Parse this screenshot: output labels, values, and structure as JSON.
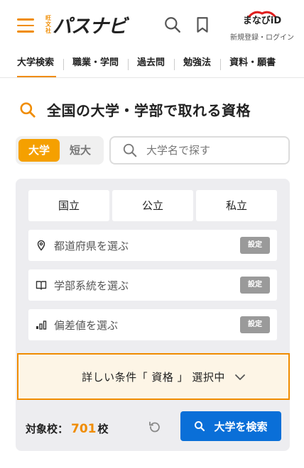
{
  "header": {
    "logo_small": [
      "旺",
      "文",
      "社"
    ],
    "logo_main": "パスナビ",
    "manabi_logo": "まなびiD",
    "manabi_sub": "新規登録・ログイン"
  },
  "nav": {
    "items": [
      {
        "label": "大学検索",
        "active": true
      },
      {
        "label": "職業・学問",
        "active": false
      },
      {
        "label": "過去問",
        "active": false
      },
      {
        "label": "勉強法",
        "active": false
      },
      {
        "label": "資料・願書",
        "active": false
      }
    ]
  },
  "section": {
    "title": "全国の大学・学部で取れる資格"
  },
  "toggle": {
    "options": [
      "大学",
      "短大"
    ],
    "selected": "大学"
  },
  "search": {
    "placeholder": "大学名で探す"
  },
  "filters": {
    "types": [
      "国立",
      "公立",
      "私立"
    ],
    "prefecture": "都道府県を選ぶ",
    "faculty": "学部系統を選ぶ",
    "deviation": "偏差値を選ぶ",
    "set_label": "設定",
    "detail": "詳しい条件「 資格 」 選択中"
  },
  "results": {
    "count_label": "対象校：",
    "count": "701",
    "count_unit": "校",
    "search_button": "大学を検索"
  },
  "colors": {
    "accent": "#f08c00",
    "primary": "#0a6fd8",
    "panel_bg": "#ededf0",
    "detail_bg": "#fdf5e6"
  }
}
